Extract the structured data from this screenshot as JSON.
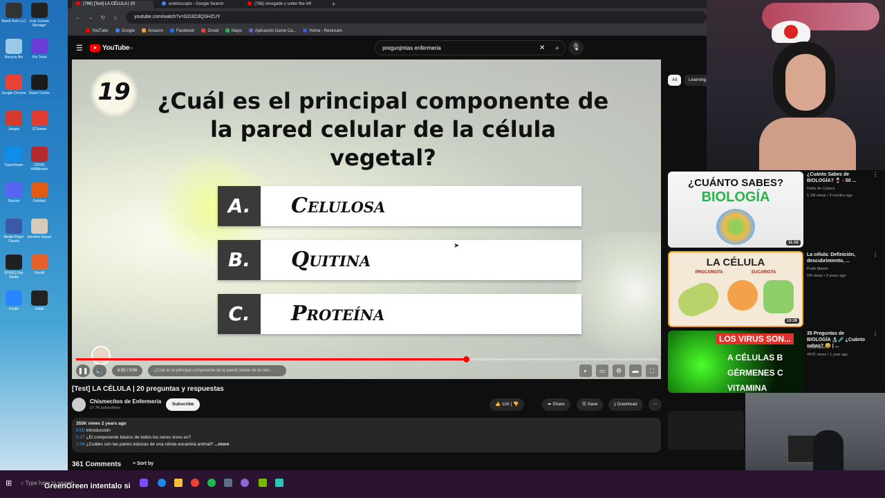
{
  "desktop": {
    "icons": [
      {
        "label": "Bandi Tech LLC",
        "color": "#333333"
      },
      {
        "label": "iLok License Manager",
        "color": "#222222"
      },
      {
        "label": "Recycle Bin",
        "color": "#9ac8e8"
      },
      {
        "label": "Pro Tools",
        "color": "#6a3dd6"
      },
      {
        "label": "Google Chrome",
        "color": "#e94235"
      },
      {
        "label": "Razer Cortex",
        "color": "#1b1b1b"
      },
      {
        "label": "Juegos",
        "color": "#d33b2c"
      },
      {
        "label": "CCleaner",
        "color": "#e03c31"
      },
      {
        "label": "TeamViewer",
        "color": "#0e8ee9"
      },
      {
        "label": "CPUID HWMonitor",
        "color": "#b8292f"
      },
      {
        "label": "Discord",
        "color": "#5865f2"
      },
      {
        "label": "FurMark",
        "color": "#e25b12"
      },
      {
        "label": "Media Player Classic",
        "color": "#3a5aa8"
      },
      {
        "label": "Genshin Impact",
        "color": "#d9c9b8"
      },
      {
        "label": "[FREE] Obs Studio",
        "color": "#202020"
      },
      {
        "label": "FireAll",
        "color": "#e8602a"
      },
      {
        "label": "Fontio",
        "color": "#2a86ff"
      },
      {
        "label": "install",
        "color": "#222222"
      }
    ]
  },
  "browser": {
    "tabs": [
      {
        "title": "(786) [Test] LA CÉLULA | 20",
        "fav": "#ff0000",
        "active": true
      },
      {
        "title": "estetoscopio - Google Search",
        "fav": "#4285f4",
        "active": false
      },
      {
        "title": "(786) renegade x under the infl",
        "fav": "#ff0000",
        "active": false
      }
    ],
    "url": "youtube.com/watch?v=GD3O3QSHZUY",
    "bookmarks": [
      "YouTube",
      "Google",
      "Amazon",
      "Facebook",
      "Gmail",
      "Maps",
      "Aplicación Game Ca...",
      "Home - Restream"
    ],
    "bookmark_colors": [
      "#ff0000",
      "#4285f4",
      "#f0a020",
      "#1877f2",
      "#ea4335",
      "#34a853",
      "#5a6bd8",
      "#3b5bdb"
    ]
  },
  "youtube": {
    "logo_text": "YouTube",
    "logo_country": "PR",
    "search_query": "pregunjmtas enfermeria",
    "video": {
      "question_number": "19",
      "question": "¿Cuál es el principal componente de la pared celular de la célula vegetal?",
      "answers": [
        {
          "letter": "A.",
          "text": "Celulosa"
        },
        {
          "letter": "B.",
          "text": "Quitina"
        },
        {
          "letter": "C.",
          "text": "Proteína"
        }
      ],
      "time": "6:35 / 9:56",
      "chapter": "¿Cuál es el principal componente de la pared celular de la céle...",
      "progress": 0.67
    },
    "title": "[Test] LA CÉLULA | 20 preguntas y respuestas",
    "channel": {
      "name": "Chismecitos de Enfermería",
      "subscribers": "17.7K subscribers",
      "subscribe_label": "Subscribe"
    },
    "actions": {
      "likes": "11K",
      "share": "Share",
      "save": "Save",
      "download": "Download"
    },
    "description": {
      "stats": "355K views  2 years ago",
      "lines": [
        {
          "ts": "0:00",
          "text": "Introducción"
        },
        {
          "ts": "0:17",
          "text": "¿El componente básico de todos los seres vivos es?"
        },
        {
          "ts": "1:04",
          "text": "¿Cuáles son las partes básicas de una célula eucariota animal?"
        }
      ],
      "more": "...more"
    },
    "comments": {
      "count": "361 Comments",
      "sort_label": "Sort by"
    },
    "chips": [
      "All",
      "Learning"
    ],
    "recommendations": [
      {
        "title": "¿Cuánto Sabes de BIOLOGÍA? 🍷 - 50 ...",
        "channel": "Doña de Cultura",
        "meta": "1.1M views • 9 months ago",
        "duration": "11:52",
        "thumb_text": "¿CUÁNTO SABES?",
        "thumb_sub": "BIOLOGÍA"
      },
      {
        "title": "La célula: Definición, descubrimiento, ...",
        "channel": "Profe Marilin",
        "meta": "1M views • 3 years ago",
        "duration": "13:16",
        "thumb_text": "LA CÉLULA",
        "thumb_sub": "PROCARIOTA  EUCARIOTA"
      },
      {
        "title": "35 Preguntas de BIOLOGÍA 🔬🧪 ¿Cuánto sabes? 😀 | ...",
        "channel": "Trivia-Reto",
        "meta": "497K views • 1 year ago",
        "duration": "",
        "thumb_text": "LOS VIRUS SON...",
        "thumb_sub": "A CÉLULAS  B GÉRMENES  C VITAMINA"
      }
    ]
  },
  "overlay": {
    "chat_text": "GreenGreen  intentalo si"
  },
  "taskbar": {
    "search_placeholder": "Type here to search"
  }
}
